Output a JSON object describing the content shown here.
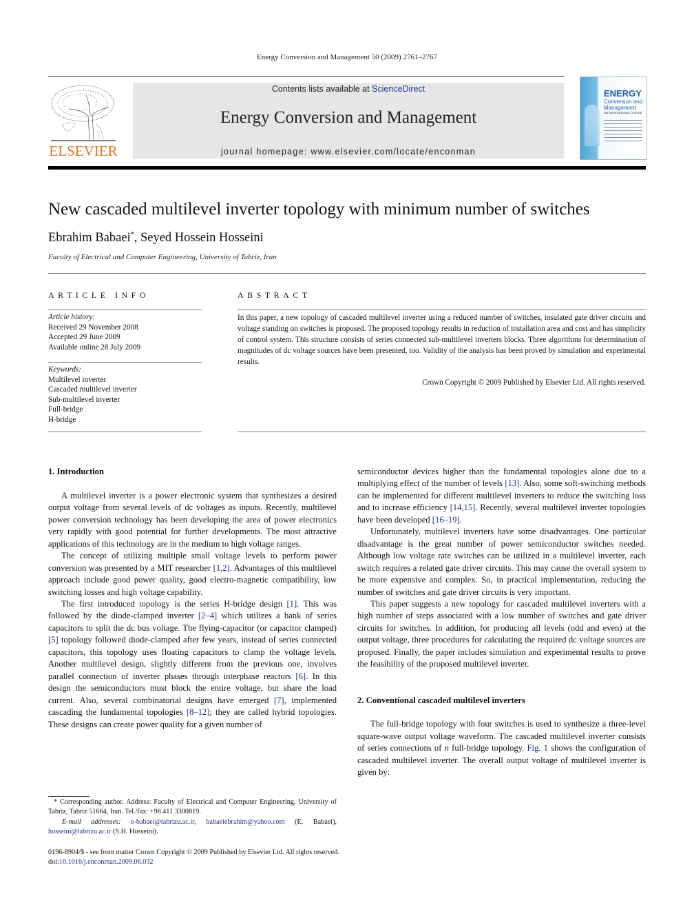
{
  "running_head": "Energy Conversion and Management 50 (2009) 2761–2767",
  "header": {
    "publisher_logo_text": "ELSEVIER",
    "contents_prefix": "Contents lists available at ",
    "contents_link": "ScienceDirect",
    "journal_title": "Energy Conversion and Management",
    "homepage": "journal homepage: www.elsevier.com/locate/enconman",
    "cover": {
      "title": "ENERGY",
      "subtitle": "Conversion and Management",
      "tagline": "An International Journal"
    }
  },
  "article": {
    "title": "New cascaded multilevel inverter topology with minimum number of switches",
    "authors_part1": "Ebrahim Babaei",
    "author_mark": "*",
    "authors_part2": ", Seyed Hossein Hosseini",
    "affiliation": "Faculty of Electrical and Computer Engineering, University of Tabriz, Iran"
  },
  "article_info": {
    "heading": "ARTICLE INFO",
    "history_label": "Article history:",
    "history": [
      "Received 29 November 2008",
      "Accepted 29 June 2009",
      "Available online 28 July 2009"
    ],
    "keywords_label": "Keywords:",
    "keywords": [
      "Multilevel inverter",
      "Cascaded multilevel inverter",
      "Sub-multilevel inverter",
      "Full-bridge",
      "H-bridge"
    ]
  },
  "abstract": {
    "heading": "ABSTRACT",
    "text": "In this paper, a new topology of cascaded multilevel inverter using a reduced number of switches, insulated gate driver circuits and voltage standing on switches is proposed. The proposed topology results in reduction of installation area and cost and has simplicity of control system. This structure consists of series connected sub-multilevel inverters blocks. Three algorithms for determination of magnitudes of dc voltage sources have been presented, too. Validity of the analysis has been proved by simulation and experimental results.",
    "copyright": "Crown Copyright © 2009 Published by Elsevier Ltd. All rights reserved."
  },
  "body": {
    "sec1_heading": "1. Introduction",
    "p1": "A multilevel inverter is a power electronic system that synthesizes a desired output voltage from several levels of dc voltages as inputs. Recently, multilevel power conversion technology has been developing the area of power electronics very rapidly with good potential for further developments. The most attractive applications of this technology are in the medium to high voltage ranges.",
    "p2a": "The concept of utilizing multiple small voltage levels to perform power conversion was presented by a MIT researcher ",
    "p2_ref": "[1,2]",
    "p2b": ". Advantages of this multilevel approach include good power quality, good electro-magnetic compatibility, low switching losses and high voltage capability.",
    "p3a": "The first introduced topology is the series H-bridge design ",
    "p3_ref1": "[1]",
    "p3b": ". This was followed by the diode-clamped inverter ",
    "p3_ref2": "[2–4]",
    "p3c": " which utilizes a bank of series capacitors to split the dc bus voltage. The flying-capacitor (or capacitor clamped) ",
    "p3_ref3": "[5]",
    "p3d": " topology followed diode-clamped after few years, instead of series connected capacitors, this topology uses floating capacitors to clamp the voltage levels. Another multilevel design, slightly different from the previous one, involves parallel connection of inverter phases through interphase reactors ",
    "p3_ref4": "[6]",
    "p3e": ". In this design the semiconductors must block the entire voltage, but share the load current. Also, several combinatorial designs have emerged ",
    "p3_ref5": "[7]",
    "p3f": ", implemented cascading the fundamental topologies ",
    "p3_ref6": "[8–12]",
    "p3g": "; they are called hybrid topologies. These designs can create power quality for a given number of semiconductor devices higher than the fundamental topologies alone due to a multiplying effect of the number of levels ",
    "p3_ref7": "[13]",
    "p3h": ". Also, some soft-switching methods can be implemented for different multilevel inverters to reduce the switching loss and to increase efficiency ",
    "p3_ref8": "[14,15]",
    "p3i": ". Recently, several multilevel inverter topologies have been developed ",
    "p3_ref9": "[16–19]",
    "p3j": ".",
    "p4": "Unfortunately, multilevel inverters have some disadvantages. One particular disadvantage is the great number of power semiconductor switches needed. Although low voltage rate switches can be utilized in a multilevel inverter, each switch requires a related gate driver circuits. This may cause the overall system to be more expensive and complex. So, in practical implementation, reducing the number of switches and gate driver circuits is very important.",
    "p5": "This paper suggests a new topology for cascaded multilevel inverters with a high number of steps associated with a low number of switches and gate driver circuits for switches. In addition, for producing all levels (odd and even) at the output voltage, three procedures for calculating the required dc voltage sources are proposed. Finally, the paper includes simulation and experimental results to prove the feasibility of the proposed multilevel inverter.",
    "sec2_heading": "2. Conventional cascaded multilevel inverters",
    "p6a": "The full-bridge topology with four switches is used to synthesize a three-level square-wave output voltage waveform. The cascaded multilevel inverter consists of series connections of ",
    "p6_n": "n",
    "p6b": " full-bridge topology. ",
    "p6_ref": "Fig. 1",
    "p6c": " shows the configuration of cascaded multilevel inverter. The overall output voltage of multilevel inverter is given by:"
  },
  "footnotes": {
    "corresponding": "* Corresponding author. Address: Faculty of Electrical and Computer Engineering, University of Tabriz, Tabriz 51664, Iran. Tel./fax: +98 411 3300819.",
    "email_label": "E-mail addresses:",
    "email1": "e-babaei@tabrizu.ac.ir",
    "email_sep": ", ",
    "email2": "babaeiebrahim@yahoo.com",
    "email2_who": " (E. Babaei),",
    "email3": "hosseini@tabrizu.ac.ir",
    "email3_who": " (S.H. Hosseini)."
  },
  "bottom": {
    "issn_line": "0196-8904/$ - see front matter Crown Copyright © 2009 Published by Elsevier Ltd. All rights reserved.",
    "doi_label": "doi:",
    "doi": "10.1016/j.enconman.2009.06.032"
  },
  "colors": {
    "link": "#1f2f86",
    "elsevier_orange": "#e87722",
    "banner_gray": "#e6e6e6"
  }
}
